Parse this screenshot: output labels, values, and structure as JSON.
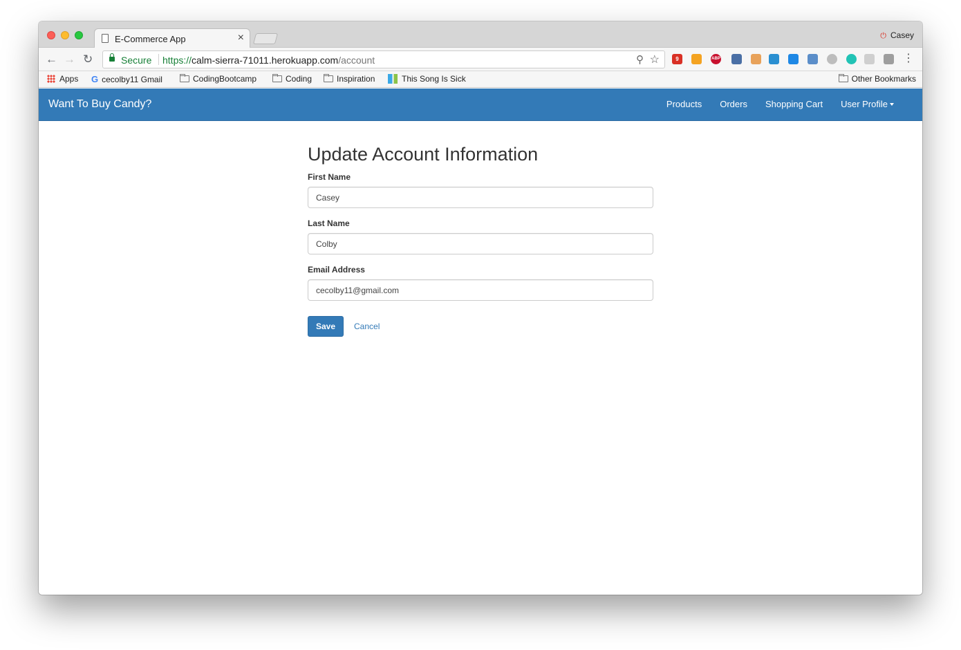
{
  "browser": {
    "tab_title": "E-Commerce App",
    "tab_close": "×",
    "profile_name": "Casey",
    "secure_label": "Secure",
    "url_scheme": "https://",
    "url_host": "calm-sierra-71011.herokuapp.com",
    "url_path": "/account",
    "gmail_badge": "9",
    "abp_label": "ABP"
  },
  "bookmarks": {
    "apps": "Apps",
    "gmail": "cecolby11 Gmail",
    "coding_bootcamp": "CodingBootcamp",
    "coding": "Coding",
    "inspiration": "Inspiration",
    "song": "This Song Is Sick",
    "other": "Other Bookmarks"
  },
  "navbar": {
    "brand": "Want To Buy Candy?",
    "links": [
      "Products",
      "Orders",
      "Shopping Cart",
      "User Profile"
    ]
  },
  "form": {
    "title": "Update Account Information",
    "first_name_label": "First Name",
    "first_name_value": "Casey",
    "last_name_label": "Last Name",
    "last_name_value": "Colby",
    "email_label": "Email Address",
    "email_value": "cecolby11@gmail.com",
    "save_label": "Save",
    "cancel_label": "Cancel"
  },
  "colors": {
    "navbar_bg": "#337ab7",
    "secure_green": "#188038",
    "link": "#337ab7"
  }
}
